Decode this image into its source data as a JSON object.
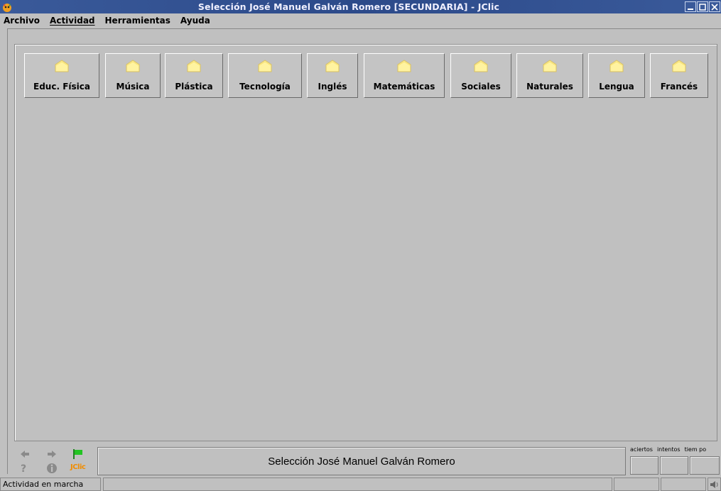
{
  "window": {
    "title": "Selección José Manuel Galván Romero [SECUNDARIA] - JClic",
    "controls": [
      "minimize-icon",
      "maximize-icon",
      "close-icon"
    ]
  },
  "menu": {
    "items": [
      {
        "label": "Archivo"
      },
      {
        "label": "Actividad"
      },
      {
        "label": "Herramientas"
      },
      {
        "label": "Ayuda"
      }
    ]
  },
  "categories": [
    {
      "label": "Educ. Física",
      "icon": "folder-icon"
    },
    {
      "label": "Música",
      "icon": "folder-icon"
    },
    {
      "label": "Plástica",
      "icon": "folder-icon"
    },
    {
      "label": "Tecnología",
      "icon": "folder-icon"
    },
    {
      "label": "Inglés",
      "icon": "folder-icon"
    },
    {
      "label": "Matemáticas",
      "icon": "folder-icon"
    },
    {
      "label": "Sociales",
      "icon": "folder-icon"
    },
    {
      "label": "Naturales",
      "icon": "folder-icon"
    },
    {
      "label": "Lengua",
      "icon": "folder-icon"
    },
    {
      "label": "Francés",
      "icon": "folder-icon"
    }
  ],
  "bottom": {
    "message": "Selección José Manuel Galván Romero",
    "logo_text": "JClic",
    "counters": {
      "aciertos_label": "aciertos",
      "intentos_label": "intentos",
      "tiempo_label": "tiem po",
      "aciertos_value": "",
      "intentos_value": "",
      "tiempo_value": ""
    }
  },
  "status": {
    "text": "Actividad en marcha"
  },
  "colors": {
    "titlebar": "#2c4a8a",
    "background": "#c0c0c0",
    "folder": "#fff3a0",
    "flag": "#22c422",
    "logo": "#f08c00"
  }
}
